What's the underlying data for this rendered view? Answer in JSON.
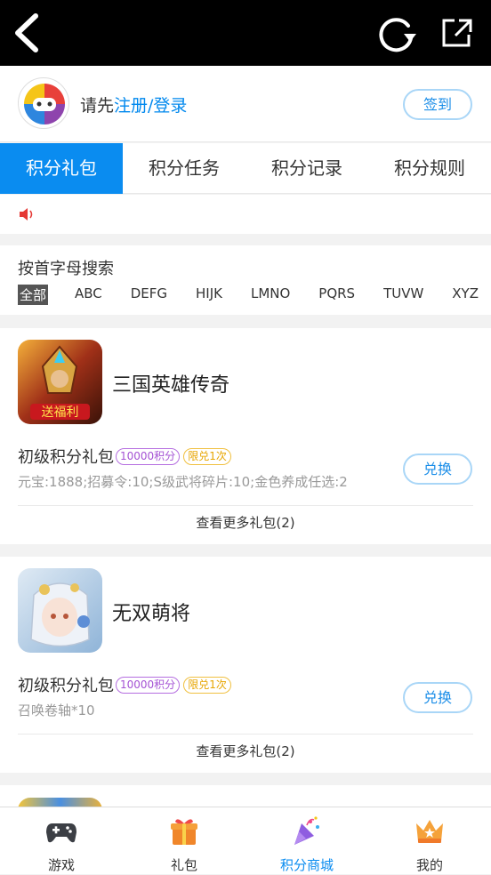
{
  "topbar": {
    "back_icon": "back-arrow-icon",
    "refresh_icon": "refresh-icon",
    "share_icon": "external-link-icon"
  },
  "user": {
    "prefix": "请先",
    "login_link": "注册/登录",
    "checkin_label": "签到"
  },
  "tabs": [
    {
      "label": "积分礼包",
      "active": true
    },
    {
      "label": "积分任务",
      "active": false
    },
    {
      "label": "积分记录",
      "active": false
    },
    {
      "label": "积分规则",
      "active": false
    }
  ],
  "notice": {
    "icon": "speaker-icon"
  },
  "search": {
    "title": "按首字母搜索",
    "letters": [
      "全部",
      "ABC",
      "DEFG",
      "HIJK",
      "LMNO",
      "PQRS",
      "TUVW",
      "XYZ"
    ],
    "active": "全部"
  },
  "games": [
    {
      "name": "三国英雄传奇",
      "icon_text": "送福利",
      "pack_name": "初级积分礼包",
      "points_badge": "10000积分",
      "limit_badge": "限兑1次",
      "desc": "元宝:1888;招募令:10;S级武将碎片:10;金色养成任选:2",
      "redeem_label": "兑换",
      "more_label": "查看更多礼包(2)"
    },
    {
      "name": "无双萌将",
      "pack_name": "初级积分礼包",
      "points_badge": "10000积分",
      "limit_badge": "限兑1次",
      "desc": "召唤卷轴*10",
      "redeem_label": "兑换",
      "more_label": "查看更多礼包(2)"
    }
  ],
  "bottom_nav": [
    {
      "label": "游戏",
      "icon": "gamepad-icon",
      "active": false
    },
    {
      "label": "礼包",
      "icon": "gift-icon",
      "active": false
    },
    {
      "label": "积分商城",
      "icon": "party-popper-icon",
      "active": true
    },
    {
      "label": "我的",
      "icon": "crown-icon",
      "active": false
    }
  ],
  "colors": {
    "accent": "#0a8cf0",
    "topbar": "#000000",
    "points_badge": "#a452d4",
    "limit_badge": "#e7a500"
  }
}
